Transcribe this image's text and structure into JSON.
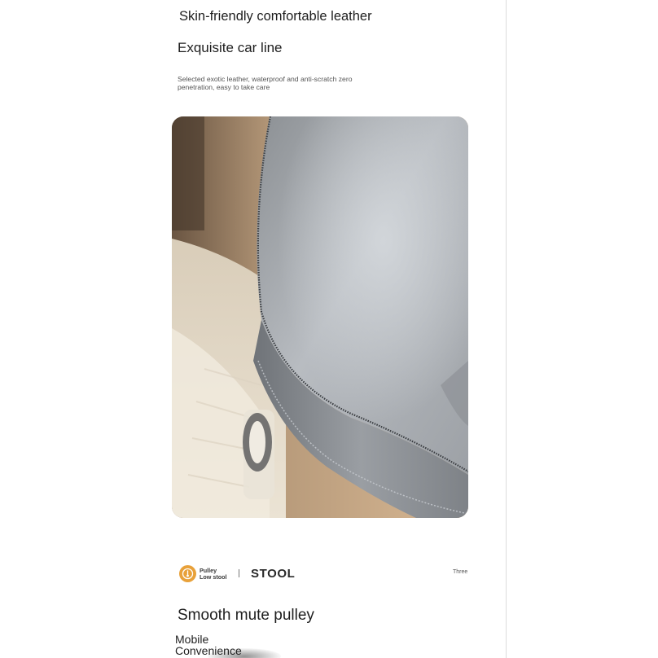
{
  "section1": {
    "title_skin": "Skin-friendly comfortable leather",
    "title_car_line": "Exquisite car line",
    "description_line1": "Selected exotic leather, waterproof and anti-scratch zero",
    "description_line2": "penetration, easy to take care"
  },
  "product_photo": {
    "subject": "grey leather stool seat close-up"
  },
  "brand_bar": {
    "logo_icon": "pulley-circle-icon",
    "logo_color": "#e8a13a",
    "small_label_line1": "Pulley",
    "small_label_line2": "Low stool",
    "name": "STOOL",
    "side_label": "Three"
  },
  "section2": {
    "title": "Smooth mute pulley",
    "subtitle_line1": "Mobile",
    "subtitle_line2": "Convenience"
  }
}
